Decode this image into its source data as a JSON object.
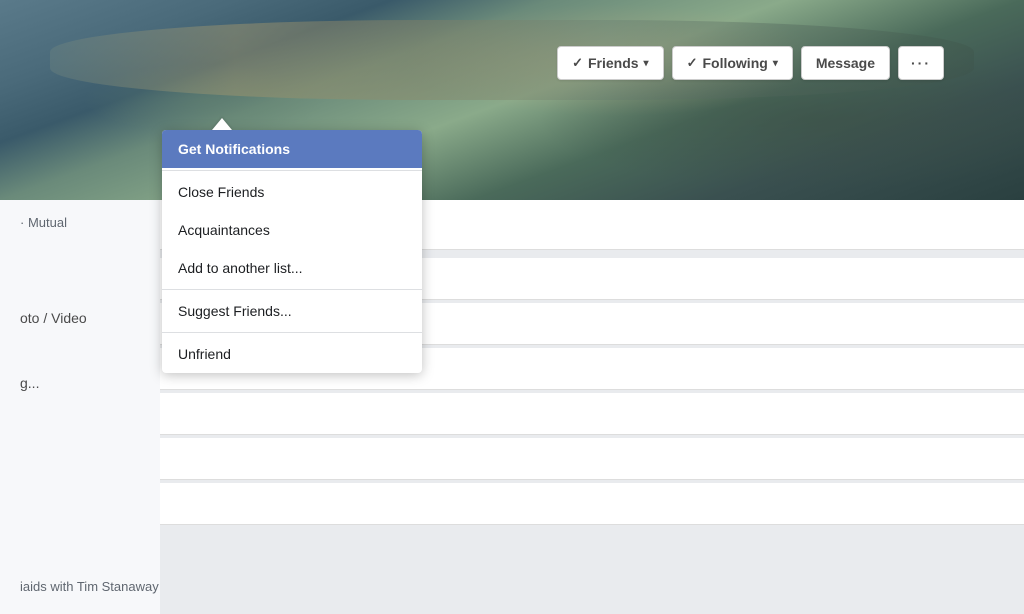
{
  "cover": {
    "alt": "Cover photo - landscape with water"
  },
  "action_bar": {
    "friends_btn": "Friends",
    "following_btn": "Following",
    "message_btn": "Message",
    "more_btn": "···",
    "check_symbol": "✓",
    "arrow_symbol": "▾"
  },
  "dropdown": {
    "items": [
      {
        "id": "get-notifications",
        "label": "Get Notifications",
        "highlighted": true
      },
      {
        "id": "divider-1",
        "type": "divider"
      },
      {
        "id": "close-friends",
        "label": "Close Friends",
        "highlighted": false
      },
      {
        "id": "acquaintances",
        "label": "Acquaintances",
        "highlighted": false
      },
      {
        "id": "add-to-list",
        "label": "Add to another list...",
        "highlighted": false
      },
      {
        "id": "divider-2",
        "type": "divider"
      },
      {
        "id": "suggest-friends",
        "label": "Suggest Friends...",
        "highlighted": false
      },
      {
        "id": "divider-3",
        "type": "divider"
      },
      {
        "id": "unfriend",
        "label": "Unfriend",
        "highlighted": false
      }
    ]
  },
  "sidebar": {
    "mutual_label": "· Mutual",
    "photo_video_label": "oto / Video",
    "typing_label": "g..."
  },
  "bottom": {
    "text": "iaids with Tim Stanaway"
  }
}
